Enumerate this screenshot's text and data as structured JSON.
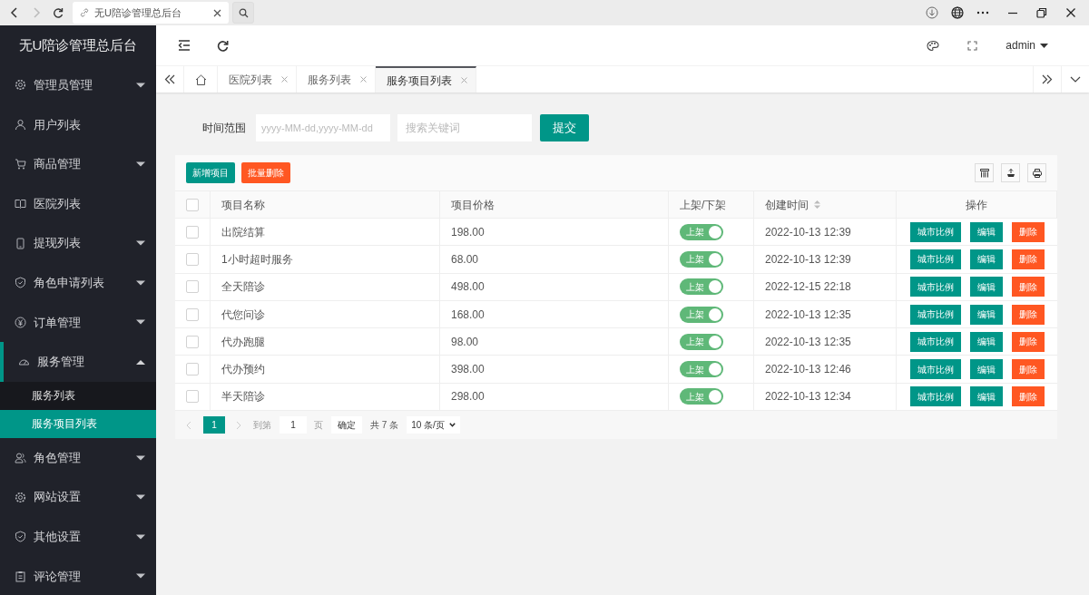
{
  "browser": {
    "tab_title": "无U陪诊管理总后台",
    "forward_disabled": true
  },
  "sidebar": {
    "title": "无U陪诊管理总后台",
    "items": [
      {
        "label": "管理员管理",
        "kind": "group",
        "expanded": false,
        "selected": false
      },
      {
        "label": "用户列表",
        "kind": "link",
        "selected": false
      },
      {
        "label": "商品管理",
        "kind": "group",
        "expanded": false,
        "selected": false
      },
      {
        "label": "医院列表",
        "kind": "link",
        "selected": false
      },
      {
        "label": "提现列表",
        "kind": "group",
        "expanded": false,
        "selected": false
      },
      {
        "label": "角色申请列表",
        "kind": "group",
        "expanded": false,
        "selected": false
      },
      {
        "label": "订单管理",
        "kind": "group",
        "expanded": false,
        "selected": false
      },
      {
        "label": "服务管理",
        "kind": "group",
        "expanded": true,
        "selected": true,
        "children": [
          {
            "label": "服务列表",
            "selected": false
          },
          {
            "label": "服务项目列表",
            "selected": true
          }
        ]
      },
      {
        "label": "角色管理",
        "kind": "group",
        "expanded": false,
        "selected": false
      },
      {
        "label": "网站设置",
        "kind": "group",
        "expanded": false,
        "selected": false
      },
      {
        "label": "其他设置",
        "kind": "group",
        "expanded": false,
        "selected": false
      },
      {
        "label": "评论管理",
        "kind": "group",
        "expanded": false,
        "selected": false
      }
    ]
  },
  "header": {
    "user": "admin"
  },
  "tabs": [
    {
      "label": "医院列表",
      "selected": false
    },
    {
      "label": "服务列表",
      "selected": false
    },
    {
      "label": "服务项目列表",
      "selected": true
    }
  ],
  "filter": {
    "label": "时间范围",
    "date_placeholder": "yyyy-MM-dd,yyyy-MM-dd",
    "keyword_placeholder": "搜索关键词",
    "submit": "提交"
  },
  "toolbar": [
    {
      "label": "新增项目",
      "kind": "primary"
    },
    {
      "label": "批量删除",
      "kind": "danger"
    }
  ],
  "table": {
    "select_all": false,
    "columns": [
      {
        "label": "项目名称",
        "sortable": false
      },
      {
        "label": "项目价格",
        "sortable": false
      },
      {
        "label": "上架/下架",
        "sortable": false
      },
      {
        "label": "创建时间",
        "sortable": true
      },
      {
        "label": "操作",
        "sortable": false
      }
    ],
    "rows": [
      {
        "checked": false,
        "name": "出院结算",
        "price": "198.00",
        "on": true,
        "switch_label": "上架",
        "created": "2022-10-13 12:39",
        "actions": [
          {
            "label": "城市比例",
            "kind": "primary"
          },
          {
            "label": "编辑",
            "kind": "primary"
          },
          {
            "label": "删除",
            "kind": "danger"
          }
        ]
      },
      {
        "checked": false,
        "name": "1小时超时服务",
        "price": "68.00",
        "on": true,
        "switch_label": "上架",
        "created": "2022-10-13 12:39",
        "actions": [
          {
            "label": "城市比例",
            "kind": "primary"
          },
          {
            "label": "编辑",
            "kind": "primary"
          },
          {
            "label": "删除",
            "kind": "danger"
          }
        ]
      },
      {
        "checked": false,
        "name": "全天陪诊",
        "price": "498.00",
        "on": true,
        "switch_label": "上架",
        "created": "2022-12-15 22:18",
        "actions": [
          {
            "label": "城市比例",
            "kind": "primary"
          },
          {
            "label": "编辑",
            "kind": "primary"
          },
          {
            "label": "删除",
            "kind": "danger"
          }
        ]
      },
      {
        "checked": false,
        "name": "代您问诊",
        "price": "168.00",
        "on": true,
        "switch_label": "上架",
        "created": "2022-10-13 12:35",
        "actions": [
          {
            "label": "城市比例",
            "kind": "primary"
          },
          {
            "label": "编辑",
            "kind": "primary"
          },
          {
            "label": "删除",
            "kind": "danger"
          }
        ]
      },
      {
        "checked": false,
        "name": "代办跑腿",
        "price": "98.00",
        "on": true,
        "switch_label": "上架",
        "created": "2022-10-13 12:35",
        "actions": [
          {
            "label": "城市比例",
            "kind": "primary"
          },
          {
            "label": "编辑",
            "kind": "primary"
          },
          {
            "label": "删除",
            "kind": "danger"
          }
        ]
      },
      {
        "checked": false,
        "name": "代办预约",
        "price": "398.00",
        "on": true,
        "switch_label": "上架",
        "created": "2022-10-13 12:46",
        "actions": [
          {
            "label": "城市比例",
            "kind": "primary"
          },
          {
            "label": "编辑",
            "kind": "primary"
          },
          {
            "label": "删除",
            "kind": "danger"
          }
        ]
      },
      {
        "checked": false,
        "name": "半天陪诊",
        "price": "298.00",
        "on": true,
        "switch_label": "上架",
        "created": "2022-10-13 12:34",
        "actions": [
          {
            "label": "城市比例",
            "kind": "primary"
          },
          {
            "label": "编辑",
            "kind": "primary"
          },
          {
            "label": "删除",
            "kind": "danger"
          }
        ]
      }
    ]
  },
  "pagination": {
    "pages": [
      {
        "label": "1",
        "selected": true
      }
    ],
    "goto_label": "到第",
    "goto_value": "1",
    "page_unit": "页",
    "confirm": "确定",
    "total": "共 7 条",
    "page_size": "10 条/页"
  }
}
